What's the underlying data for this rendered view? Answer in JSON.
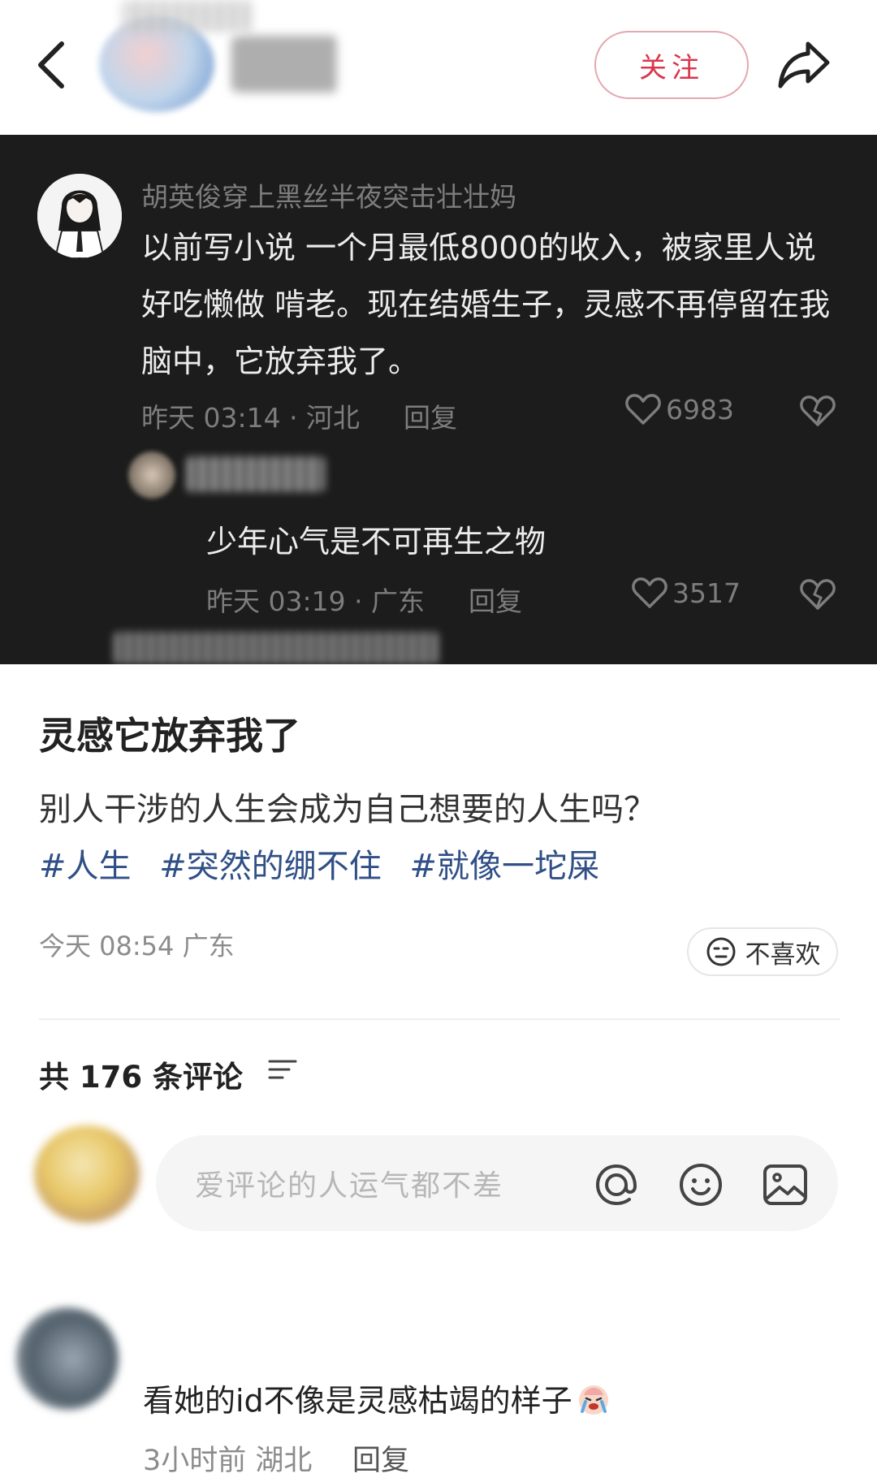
{
  "header": {
    "follow_label": "关注"
  },
  "embedded_comment": {
    "author": "胡英俊穿上黑丝半夜突击壮壮妈",
    "text": "以前写小说 一个月最低8000的收入，被家里人说好吃懒做 啃老。现在结婚生子，灵感不再停留在我脑中，它放弃我了。",
    "meta": "昨天 03:14 · 河北",
    "reply_label": "回复",
    "likes": "6983",
    "reply": {
      "text": "少年心气是不可再生之物",
      "meta": "昨天 03:19 · 广东",
      "reply_label": "回复",
      "likes": "3517"
    }
  },
  "post": {
    "title": "灵感它放弃我了",
    "body": "别人干涉的人生会成为自己想要的人生吗？",
    "tags": [
      "#人生",
      "#突然的绷不住",
      "#就像一坨屎"
    ],
    "meta": "今天 08:54 广东",
    "dislike_label": "不喜欢"
  },
  "comments": {
    "count_label": "共 176 条评论",
    "input_placeholder": "爱评论的人运气都不差",
    "items": [
      {
        "text": "看她的id不像是灵感枯竭的样子",
        "meta": "3小时前 湖北",
        "reply_label": "回复"
      }
    ]
  },
  "colors": {
    "accent_red": "#d9364b",
    "tag_blue": "#2f4f86",
    "dark_panel": "#1c1c1c"
  }
}
